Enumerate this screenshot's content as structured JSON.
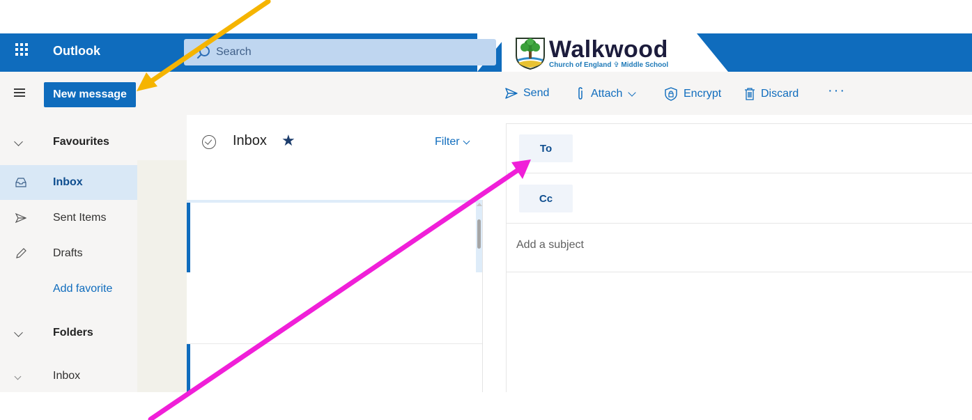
{
  "app": {
    "name": "Outlook"
  },
  "search": {
    "placeholder": "Search"
  },
  "logo": {
    "brand": "Walkwood",
    "subtitle": "Church of England ✞ Middle School"
  },
  "toolbar": {
    "new_message": "New message",
    "send": "Send",
    "attach": "Attach",
    "encrypt": "Encrypt",
    "discard": "Discard",
    "more": "···"
  },
  "nav": {
    "favourites": "Favourites",
    "inbox": "Inbox",
    "sent_items": "Sent Items",
    "drafts": "Drafts",
    "add_favorite": "Add favorite",
    "folders": "Folders",
    "folder_inbox": "Inbox"
  },
  "list": {
    "title": "Inbox",
    "filter": "Filter"
  },
  "compose": {
    "to_label": "To",
    "cc_label": "Cc",
    "subject_placeholder": "Add a subject"
  },
  "colors": {
    "accent": "#0f6cbd",
    "selected": "#d9e8f6",
    "annotation_arrow_1": "#f5b400",
    "annotation_arrow_2": "#f01fd8"
  },
  "icons": {
    "waffle": "app-launcher-icon",
    "search": "search-icon",
    "send": "send-icon",
    "attach": "paperclip-icon",
    "encrypt": "shield-lock-icon",
    "discard": "trash-icon",
    "inbox": "inbox-tray-icon",
    "sent": "send-outline-icon",
    "drafts": "pencil-icon"
  }
}
